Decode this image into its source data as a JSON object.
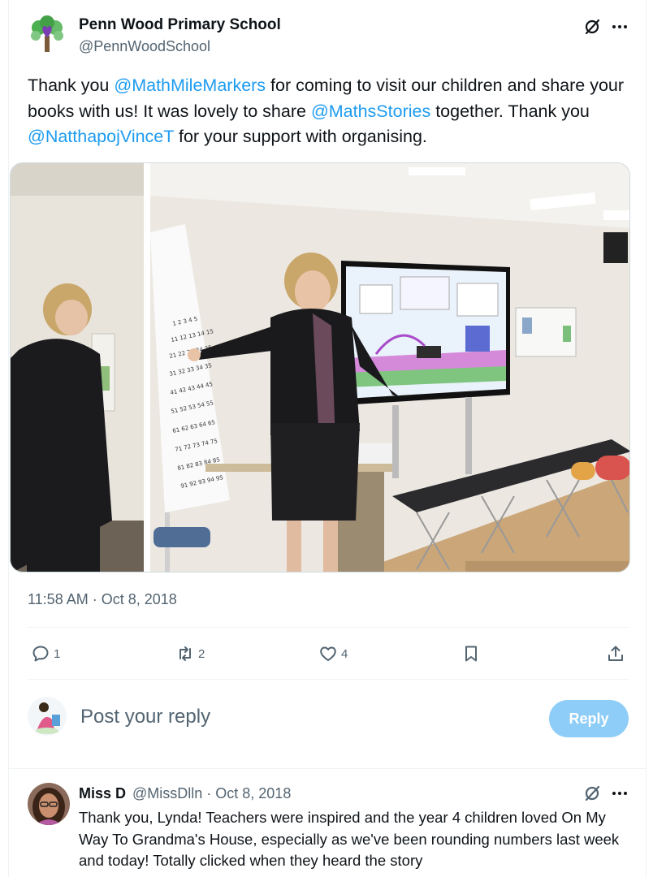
{
  "tweet": {
    "author_name": "Penn Wood Primary School",
    "author_handle": "@PennWoodSchool",
    "text_parts": [
      {
        "text": "Thank you ",
        "mention": false
      },
      {
        "text": "@MathMileMarkers",
        "mention": true
      },
      {
        "text": " for coming to visit our children and share your books with us! It was lovely to share ",
        "mention": false
      },
      {
        "text": "@MathsStories",
        "mention": true
      },
      {
        "text": " together. Thank you ",
        "mention": false
      },
      {
        "text": "@NatthapojVinceT",
        "mention": true
      },
      {
        "text": " for your support with organising.",
        "mention": false
      }
    ],
    "timestamp": "11:58 AM · Oct 8, 2018",
    "icons": {
      "grok": "grok-icon",
      "more": "more-icon"
    }
  },
  "actions": {
    "replies": "1",
    "reposts": "2",
    "likes": "4",
    "bookmark_icon": "bookmark-icon",
    "share_icon": "share-icon"
  },
  "composer": {
    "placeholder": "Post your reply",
    "reply_button": "Reply"
  },
  "reply": {
    "name": "Miss D",
    "meta": "@MissDlln · Oct 8, 2018",
    "text": "Thank you, Lynda! Teachers were inspired and the year 4 children loved On My Way To Grandma's House, especially as we've been rounding numbers last week and today! Totally clicked when they heard the story"
  },
  "colors": {
    "accent": "#1d9bf0",
    "secondary_text": "#536471",
    "reply_button_disabled": "#8ecdf8"
  }
}
